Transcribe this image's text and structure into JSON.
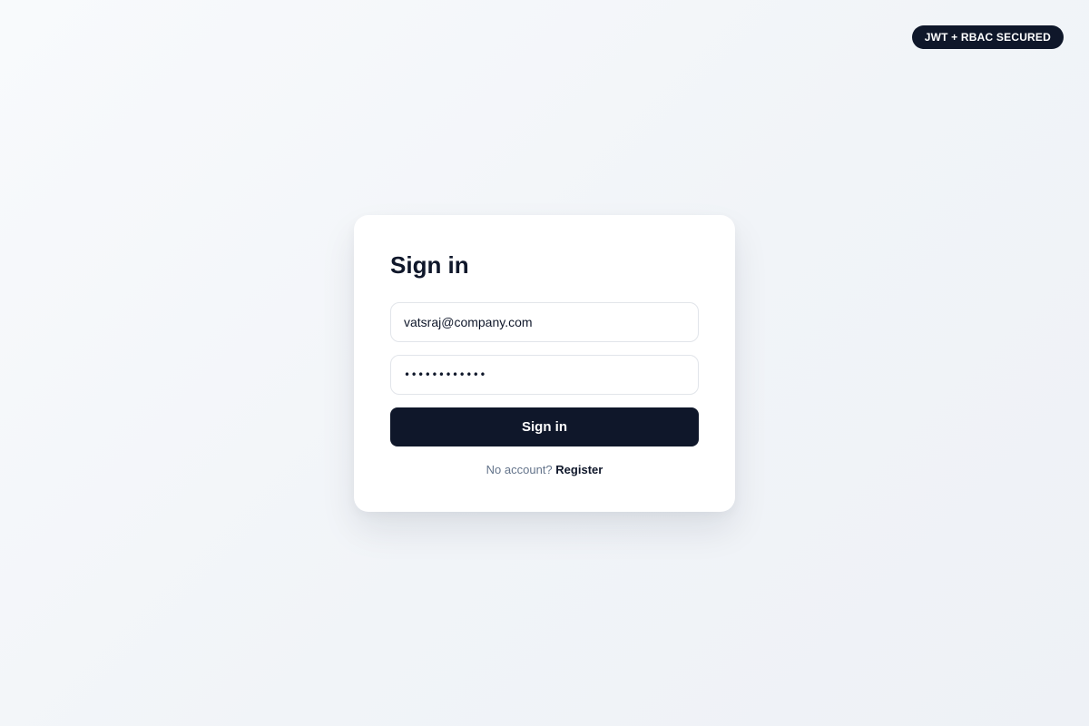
{
  "badge": {
    "label": "JWT + RBAC SECURED"
  },
  "login": {
    "title": "Sign in",
    "email_value": "vatsraj@company.com",
    "password_value": "••••••••••••",
    "submit_label": "Sign in",
    "footer_prompt": "No account?",
    "register_label": "Register"
  },
  "colors": {
    "primary": "#0f172a",
    "muted_text": "#64748b",
    "input_border": "#e2e5ea",
    "card_background": "#ffffff"
  }
}
